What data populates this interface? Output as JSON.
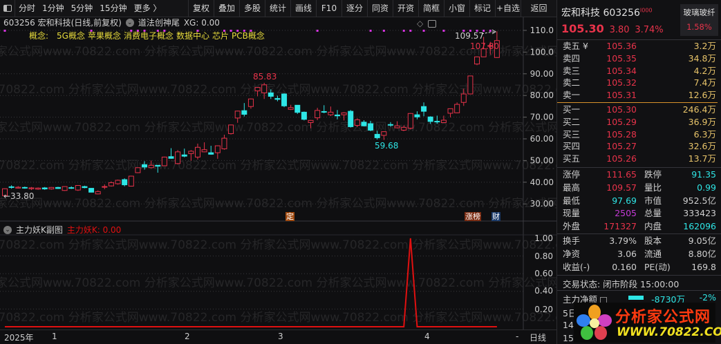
{
  "toolbar": {
    "left": [
      "分时",
      "1分钟",
      "5分钟",
      "15分钟",
      "更多 〉"
    ],
    "right": [
      "复权",
      "叠加",
      "多股",
      "统计",
      "画线",
      "F10",
      "逐分",
      "同资",
      "开资",
      "简框",
      "小窗",
      "标记",
      "+自选"
    ],
    "back": "返回"
  },
  "chart_header": {
    "title": "603256 宏和科技(日线,前复权)",
    "indicator": "道法创神尾",
    "xg": "XG: 0.00",
    "concepts_label": "概念:",
    "concepts": [
      "5G概念",
      "苹果概念",
      "消费电子概念",
      "数据中心",
      "芯片",
      "PCB概念"
    ]
  },
  "watermark": "分析家公式网www.70822.com",
  "annotations": {
    "high_label": "85.83",
    "low_label": "59.68",
    "start_label": "←33.80",
    "max_label": "109.57",
    "recent_label": "107.80"
  },
  "markers": {
    "ding": "定",
    "zhangbang": "涨榜",
    "cai": "财"
  },
  "sub_chart": {
    "title": "主力妖K副图",
    "value_label": "主力妖K: 0.00",
    "axis": [
      "1.00",
      "0.80",
      "0.60",
      "0.40",
      "0.20"
    ]
  },
  "date_axis": {
    "year": "2025年",
    "months": [
      "1",
      "2",
      "3",
      "4"
    ],
    "dash": "-",
    "period": "日线"
  },
  "chart_data": {
    "type": "candlestick",
    "y_axis": [
      "110.0",
      "100.0",
      "90.00",
      "80.00",
      "70.00",
      "60.00",
      "50.00",
      "40.00",
      "30.00"
    ],
    "ylim": [
      30,
      110
    ],
    "colors": {
      "up": "#e8334a",
      "down": "#2ee6e6",
      "signal": "#d633e0",
      "sub_line": "#e01010"
    },
    "candles": [
      [
        33.8,
        37.2,
        33.8,
        37.0
      ],
      [
        37.9,
        38.6,
        37.0,
        37.7
      ],
      [
        37.3,
        38.2,
        37.1,
        37.7
      ],
      [
        37.6,
        38.0,
        37.0,
        37.3
      ],
      [
        37.0,
        37.8,
        36.4,
        37.4
      ],
      [
        36.8,
        37.6,
        36.5,
        37.3
      ],
      [
        37.4,
        37.8,
        36.5,
        36.9
      ],
      [
        36.9,
        37.8,
        36.6,
        37.6
      ],
      [
        37.6,
        37.9,
        36.9,
        37.1
      ],
      [
        36.2,
        38.1,
        36.0,
        38.0
      ],
      [
        37.5,
        38.1,
        36.9,
        37.4
      ],
      [
        36.4,
        38.6,
        36.0,
        38.5
      ],
      [
        38.0,
        38.4,
        37.2,
        37.5
      ],
      [
        37.2,
        37.3,
        35.3,
        35.4
      ],
      [
        34.6,
        36.2,
        34.4,
        35.7
      ],
      [
        37.8,
        39.0,
        36.8,
        38.0
      ],
      [
        38.3,
        40.4,
        38.0,
        39.8
      ],
      [
        39.3,
        41.2,
        38.9,
        40.9
      ],
      [
        41.2,
        41.8,
        38.1,
        38.8
      ],
      [
        38.2,
        43.0,
        38.0,
        42.8
      ],
      [
        44.4,
        46.8,
        44.2,
        46.7
      ],
      [
        48.1,
        49.7,
        45.8,
        47.0
      ],
      [
        46.7,
        50.0,
        46.5,
        47.8
      ],
      [
        47.8,
        47.9,
        44.4,
        47.4
      ],
      [
        47.6,
        51.8,
        47.4,
        51.6
      ],
      [
        51.8,
        55.7,
        50.8,
        51.0
      ],
      [
        48.6,
        54.8,
        48.2,
        54.0
      ],
      [
        52.6,
        55.5,
        51.5,
        52.0
      ],
      [
        53.2,
        54.8,
        49.9,
        54.3
      ],
      [
        51.6,
        57.8,
        50.5,
        56.1
      ],
      [
        54.0,
        58.4,
        53.8,
        55.0
      ],
      [
        53.6,
        56.8,
        52.7,
        52.9
      ],
      [
        53.6,
        57.0,
        50.8,
        56.8
      ],
      [
        55.4,
        61.9,
        55.0,
        60.3
      ],
      [
        62.4,
        66.6,
        62.0,
        66.4
      ],
      [
        69.6,
        73.0,
        67.4,
        72.8
      ],
      [
        73.0,
        76.5,
        70.3,
        71.3
      ],
      [
        74.9,
        78.6,
        73.9,
        78.4
      ],
      [
        82.1,
        83.9,
        79.6,
        83.7
      ],
      [
        81.2,
        85.83,
        78.4,
        84.9
      ],
      [
        81.2,
        82.8,
        78.4,
        79.6
      ],
      [
        78.6,
        79.9,
        77.3,
        78.2
      ],
      [
        80.7,
        81.0,
        74.6,
        75.2
      ],
      [
        73.6,
        75.7,
        73.3,
        74.4
      ],
      [
        75.5,
        75.6,
        71.5,
        72.2
      ],
      [
        72.3,
        72.6,
        68.5,
        69.0
      ],
      [
        67.5,
        68.7,
        64.9,
        68.5
      ],
      [
        69.7,
        74.3,
        68.6,
        73.1
      ],
      [
        72.6,
        75.5,
        71.8,
        72.3
      ],
      [
        71.1,
        74.9,
        70.5,
        72.3
      ],
      [
        71.0,
        73.3,
        69.0,
        70.6
      ],
      [
        71.1,
        72.3,
        68.5,
        72.0
      ],
      [
        72.7,
        73.3,
        65.2,
        65.6
      ],
      [
        66.2,
        69.5,
        65.4,
        68.8
      ],
      [
        67.7,
        68.6,
        65.7,
        66.0
      ],
      [
        67.0,
        68.3,
        63.5,
        64.0
      ],
      [
        62.1,
        63.7,
        59.68,
        60.5
      ],
      [
        61.6,
        63.5,
        59.5,
        63.3
      ],
      [
        66.6,
        67.7,
        65.6,
        66.4
      ],
      [
        65.1,
        68.1,
        64.8,
        66.0
      ],
      [
        64.0,
        66.2,
        63.6,
        65.3
      ],
      [
        64.9,
        71.9,
        64.3,
        71.7
      ],
      [
        71.1,
        72.7,
        69.0,
        70.1
      ],
      [
        74.9,
        76.8,
        70.4,
        72.7
      ],
      [
        70.1,
        70.4,
        66.9,
        68.0
      ],
      [
        68.1,
        70.7,
        66.9,
        67.8
      ],
      [
        67.5,
        70.7,
        67.4,
        68.6
      ],
      [
        71.8,
        74.0,
        69.9,
        73.9
      ],
      [
        72.0,
        76.8,
        71.8,
        75.9
      ],
      [
        76.8,
        83.1,
        75.2,
        80.7
      ],
      [
        80.7,
        89.1,
        80.5,
        89.0
      ],
      [
        94.5,
        98.0,
        93.97,
        97.8
      ],
      [
        97.8,
        107.0,
        97.7,
        101.5
      ],
      [
        103.0,
        104.7,
        98.8,
        103.0
      ],
      [
        97.5,
        109.57,
        97.3,
        105.3
      ]
    ],
    "signal_indices": [
      0,
      13,
      19,
      20,
      21,
      23,
      24,
      29,
      33,
      34,
      35,
      36,
      37,
      47,
      55,
      57,
      60,
      61,
      63,
      66,
      69,
      70,
      71,
      72,
      73
    ],
    "sub_series_peak_index": 61,
    "sub_ylim": [
      0,
      1
    ]
  },
  "quote": {
    "name": "宏和科技",
    "code": "603256",
    "badge": "I000",
    "price": "105.30",
    "change": "3.80",
    "change_pct": "3.74%",
    "sector": "玻璃玻纤",
    "sector_pct": "1.58%"
  },
  "order_book": {
    "asks": [
      {
        "label": "卖五 ¥",
        "price": "105.36",
        "vol": "3.2万"
      },
      {
        "label": "卖四",
        "price": "105.35",
        "vol": "34.8万"
      },
      {
        "label": "卖三",
        "price": "105.34",
        "vol": "4.2万"
      },
      {
        "label": "卖二",
        "price": "105.32",
        "vol": "7.4万"
      },
      {
        "label": "卖一",
        "price": "105.31",
        "vol": "12.6万"
      }
    ],
    "bids": [
      {
        "label": "买一",
        "price": "105.30",
        "vol": "246.4万"
      },
      {
        "label": "买二",
        "price": "105.29",
        "vol": "36.9万"
      },
      {
        "label": "买三",
        "price": "105.28",
        "vol": "6.3万"
      },
      {
        "label": "买四",
        "price": "105.27",
        "vol": "32.6万"
      },
      {
        "label": "买五",
        "price": "105.26",
        "vol": "13.7万"
      }
    ]
  },
  "stats": [
    {
      "l1": "涨停",
      "v1": "111.65",
      "c1": "red",
      "l2": "跌停",
      "v2": "91.35",
      "c2": "cyan"
    },
    {
      "l1": "最高",
      "v1": "109.57",
      "c1": "red",
      "l2": "量比",
      "v2": "0.99",
      "c2": "cyan"
    },
    {
      "l1": "最低",
      "v1": "97.69",
      "c1": "cyan",
      "l2": "市值",
      "v2": "952.5亿",
      "c2": "wht"
    },
    {
      "l1": "现量",
      "v1": "2505",
      "c1": "mag",
      "l2": "总量",
      "v2": "333423",
      "c2": "wht"
    },
    {
      "l1": "外盘",
      "v1": "171327",
      "c1": "red",
      "l2": "内盘",
      "v2": "162096",
      "c2": "cyan"
    }
  ],
  "stats2": [
    {
      "l1": "换手",
      "v1": "3.79%",
      "l2": "股本",
      "v2": "9.05亿"
    },
    {
      "l1": "净资",
      "v1": "3.06",
      "l2": "流通",
      "v2": "8.80亿"
    },
    {
      "l1": "收益(-)",
      "v1": "0.160",
      "l2": "PE(动)",
      "v2": "169.8"
    }
  ],
  "status": {
    "trade_state": "交易状态: 闭市阶段 15:00:00"
  },
  "capital": {
    "label": "主力净额",
    "value": "-8730万",
    "pct": "-2%",
    "row2": "5日",
    "row3": "14:",
    "row4": "15:"
  },
  "logo": {
    "title": "分析家公式网",
    "url": "WWW.70822.COM"
  }
}
